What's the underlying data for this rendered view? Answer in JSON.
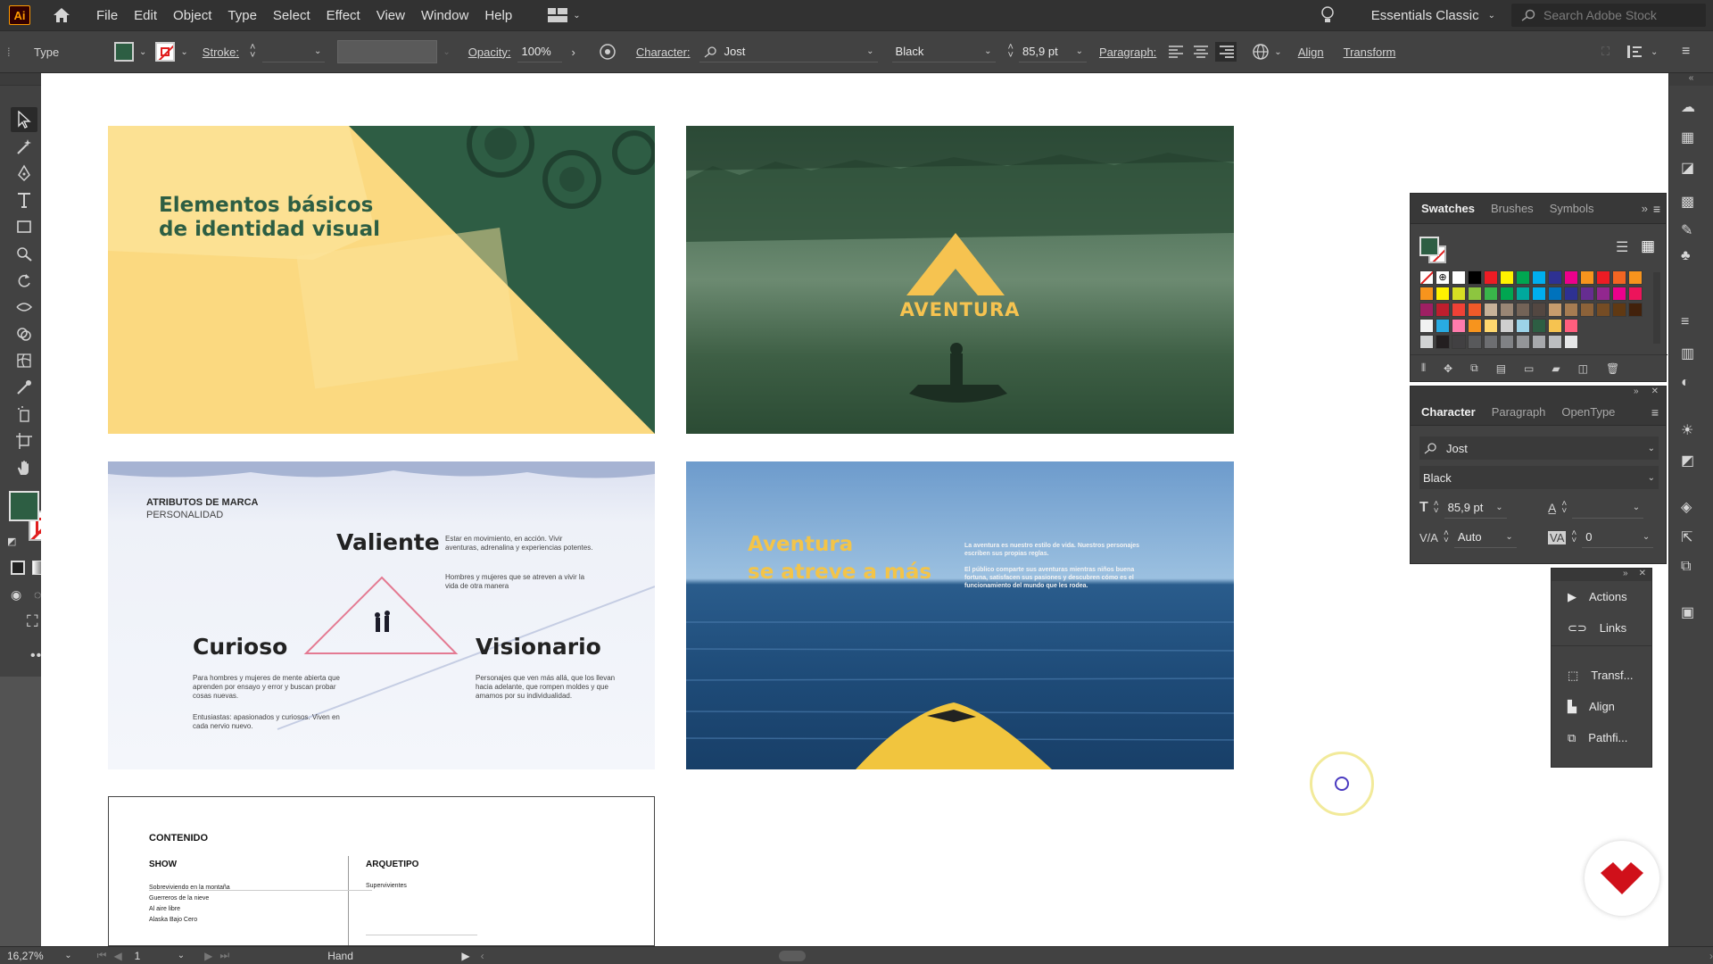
{
  "app": {
    "logo": "Ai",
    "menus": [
      "File",
      "Edit",
      "Object",
      "Type",
      "Select",
      "Effect",
      "View",
      "Window",
      "Help"
    ]
  },
  "workspace": {
    "name": "Essentials Classic"
  },
  "search": {
    "placeholder": "Search Adobe Stock"
  },
  "control_bar": {
    "tool_name": "Type",
    "stroke_label": "Stroke:",
    "opacity_label": "Opacity:",
    "opacity_value": "100%",
    "character_label": "Character:",
    "font_family": "Jost",
    "font_style": "Black",
    "font_size": "85,9 pt",
    "paragraph_label": "Paragraph:",
    "align_label": "Align",
    "transform_label": "Transform"
  },
  "artboards": {
    "a1": {
      "title_line1": "Elementos básicos",
      "title_line2": "de identidad visual"
    },
    "a2": {
      "brand": "AVENTURA"
    },
    "a3": {
      "heading": "ATRIBUTOS DE MARCA",
      "subheading": "PERSONALIDAD",
      "valiente": "Valiente",
      "valiente_text1": "Estar en movimiento, en acción. Vivir aventuras, adrenalina y experiencias potentes.",
      "valiente_text2": "Hombres y mujeres que se atreven a vivir la vida de otra manera",
      "curioso": "Curioso",
      "curioso_text1": "Para hombres y mujeres de mente abierta que aprenden por ensayo y error y buscan probar cosas nuevas.",
      "curioso_text2": "Entusiastas: apasionados y curiosos. Viven en cada nervio nuevo.",
      "visionario": "Visionario",
      "visionario_text": "Personajes que ven más allá, que los llevan hacia adelante, que rompen moldes y que amamos por su individualidad."
    },
    "a4": {
      "headline1": "Aventura",
      "headline2": "se atreve a más",
      "body1": "La aventura es nuestro estilo de vida. Nuestros personajes escriben sus propias reglas.",
      "body2": "El público comparte sus aventuras mientras niños buena fortuna, satisfacen sus pasiones y descubren cómo es el funcionamiento del mundo que les rodea."
    },
    "a5": {
      "contenido": "CONTENIDO",
      "show": "SHOW",
      "arquetipo": "ARQUETIPO",
      "show_items": [
        "Sobreviviendo en la montaña",
        "Guerreros de la nieve",
        "Al aire libre",
        "Alaska Bajo Cero"
      ],
      "arquetipo_items": [
        "Supervivientes"
      ]
    }
  },
  "swatches_panel": {
    "tabs": [
      "Swatches",
      "Brushes",
      "Symbols"
    ]
  },
  "character_panel": {
    "tabs": [
      "Character",
      "Paragraph",
      "OpenType"
    ],
    "font_family": "Jost",
    "font_style": "Black",
    "size": "85,9 pt",
    "leading": "",
    "kerning": "Auto",
    "tracking": "0"
  },
  "mini_panel": {
    "items": [
      "Actions",
      "Links",
      "Transf...",
      "Align",
      "Pathfi..."
    ]
  },
  "status": {
    "zoom": "16,27%",
    "artboard": "1",
    "tool": "Hand"
  },
  "colors": {
    "accent_green": "#2d5e43",
    "yellow": "#ffd76e",
    "brand_red": "#d0101a"
  }
}
